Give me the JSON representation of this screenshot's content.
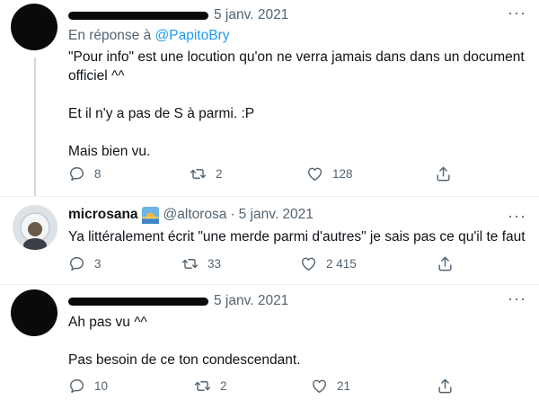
{
  "tweets": [
    {
      "author_hidden": true,
      "date": "5 janv. 2021",
      "reply_to_prefix": "En réponse à",
      "reply_to_handle": "@PapitoBry",
      "body": [
        "\"Pour info\" est une locution qu'on ne verra jamais dans dans un document officiel ^^",
        "Et il n'y a pas de S à parmi. :P",
        "Mais bien vu."
      ],
      "replies": "8",
      "retweets": "2",
      "likes": "128"
    },
    {
      "name": "microsana",
      "name_emoji": "sunrise-icon",
      "handle": "@altorosa",
      "date": "5 janv. 2021",
      "body": [
        "Ya littéralement écrit \"une merde parmi d'autres\" je sais pas ce qu'il te faut"
      ],
      "replies": "3",
      "retweets": "33",
      "likes": "2 415"
    },
    {
      "author_hidden": true,
      "date": "5 janv. 2021",
      "body": [
        "Ah pas vu ^^",
        "Pas besoin de ce ton condescendant."
      ],
      "replies": "10",
      "retweets": "2",
      "likes": "21"
    }
  ],
  "separator": "·",
  "more_glyph": "···",
  "colors": {
    "accent": "#1d9bf0",
    "secondary_text": "#536471",
    "primary_text": "#0f1419",
    "thread_line": "#cfd9de"
  }
}
